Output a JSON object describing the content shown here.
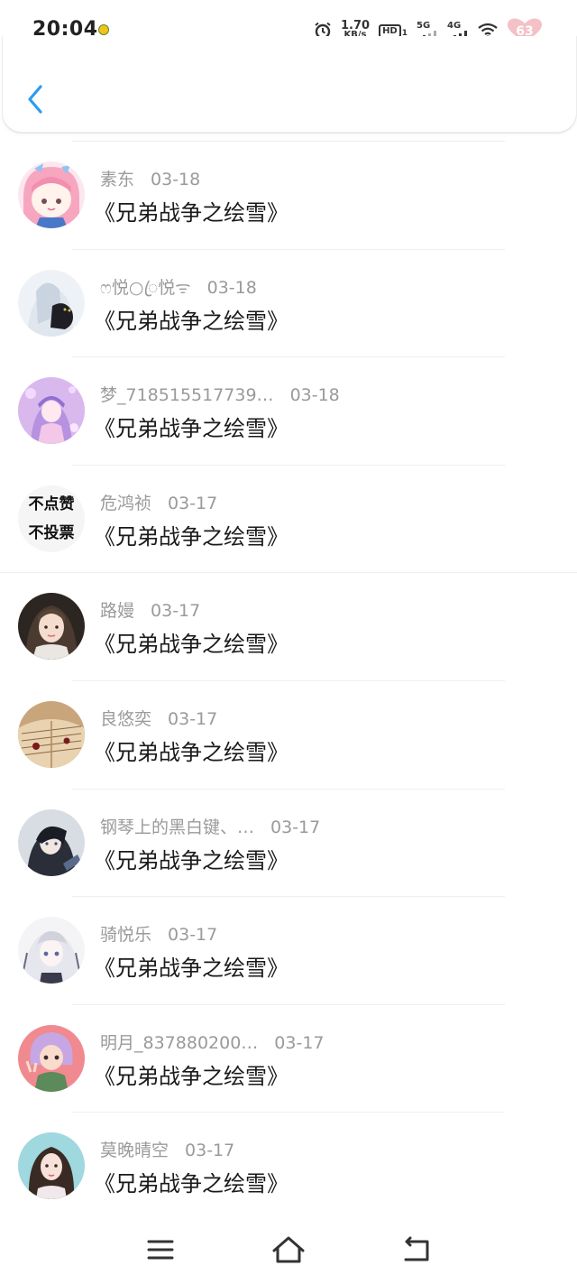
{
  "status_bar": {
    "time": "20:04",
    "network_speed_value": "1.70",
    "network_speed_unit": "KB/s",
    "hd_label": "HD",
    "hd_sub": "1",
    "signal_5g": "5G",
    "signal_4g": "4G",
    "battery_level": "63",
    "icons": [
      "notification-icon",
      "alarm-icon",
      "hd-icon",
      "signal-5g-icon",
      "signal-4g-icon",
      "wifi-icon",
      "battery-icon"
    ]
  },
  "header": {
    "back_icon": "chevron-left-icon",
    "accent_color": "#2b9cf2"
  },
  "entries": [
    {
      "name": "素东",
      "date": "03-18",
      "title": "《兄弟战争之绘雪》",
      "avatar": "anime-girl-pink"
    },
    {
      "name": "ෆ悦○ꦿ悦ᯤ",
      "date": "03-18",
      "title": "《兄弟战争之绘雪》",
      "avatar": "girl-with-cat"
    },
    {
      "name": "梦_718515517739…",
      "date": "03-18",
      "title": "《兄弟战争之绘雪》",
      "avatar": "anime-girl-purple"
    },
    {
      "name": "危鸿祯",
      "date": "03-17",
      "title": "《兄弟战争之绘雪》",
      "avatar": "text-avatar",
      "avatar_text_1": "不点赞",
      "avatar_text_2": "不投票"
    },
    {
      "name": "路嫚",
      "date": "03-17",
      "title": "《兄弟战争之绘雪》",
      "avatar": "photo-girl"
    },
    {
      "name": "良悠奕",
      "date": "03-17",
      "title": "《兄弟战争之绘雪》",
      "avatar": "book-pages"
    },
    {
      "name": "钢琴上的黑白键、…",
      "date": "03-17",
      "title": "《兄弟战争之绘雪》",
      "avatar": "anime-boy"
    },
    {
      "name": "骑悦乐",
      "date": "03-17",
      "title": "《兄弟战争之绘雪》",
      "avatar": "anime-girl-white"
    },
    {
      "name": "明月_837880200…",
      "date": "03-17",
      "title": "《兄弟战争之绘雪》",
      "avatar": "3d-girl"
    },
    {
      "name": "莫晚晴空",
      "date": "03-17",
      "title": "《兄弟战争之绘雪》",
      "avatar": "photo-girl-2"
    }
  ],
  "nav_bar": {
    "icons": [
      "menu-icon",
      "home-icon",
      "back-nav-icon"
    ]
  }
}
